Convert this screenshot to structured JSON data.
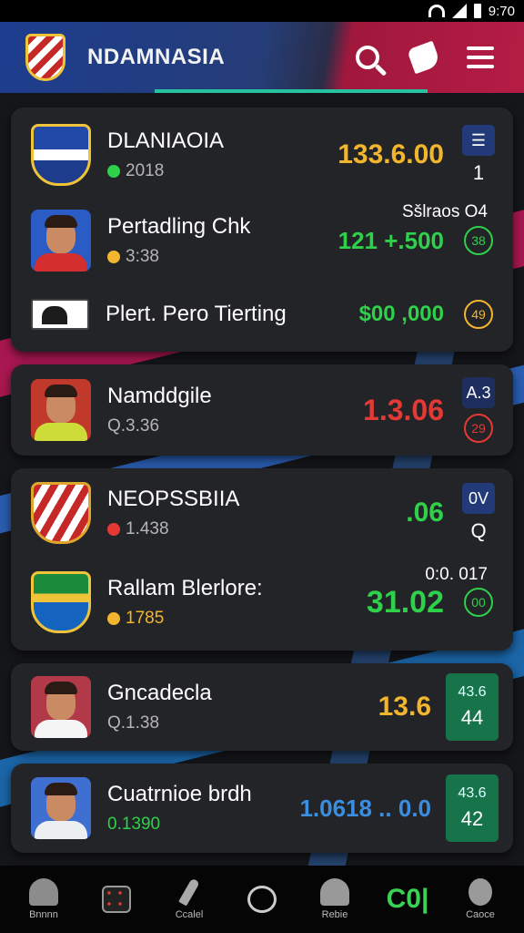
{
  "status_bar": {
    "time": "9:70"
  },
  "header": {
    "app_title": "NDAMNASIA",
    "icons": [
      "search-icon",
      "tag-icon",
      "menu-icon"
    ]
  },
  "cards": [
    {
      "rows": [
        {
          "name": "DLANIAOIA",
          "sub": "2018",
          "value": "133.6.00",
          "value_color": "#f2b62e",
          "chip": "",
          "badge": "1",
          "icon": "team-crest-icon"
        },
        {
          "name": "Pertadling Chk",
          "sub": "3:38",
          "value": "121 +.500",
          "value_color": "#2fd04a",
          "top_right": "Sšlraos O4",
          "ring": "38",
          "ring_color": "#2fd04a",
          "icon": "player-avatar"
        },
        {
          "name": "Plert. Pero Tierting",
          "sub": "",
          "value": "$00 ,000",
          "value_color": "#2fd04a",
          "ring": "49",
          "ring_color": "#f2b62e",
          "icon": "brand-logo"
        }
      ]
    },
    {
      "rows": [
        {
          "name": "Namddgile",
          "sub": "Q.3.36",
          "value": "1.3.06",
          "value_color": "#e53935",
          "chip": "A.3",
          "ring": "29",
          "ring_color": "#e53935",
          "icon": "player-avatar"
        }
      ]
    },
    {
      "rows": [
        {
          "name": "NEOPSSBIIA",
          "sub": "1.438",
          "value": ".06",
          "value_color": "#2fd04a",
          "chip": "0V",
          "badge": "Q",
          "icon": "team-crest-icon"
        },
        {
          "name": "Rallam Blerlore:",
          "sub": "1785",
          "value": "31.02",
          "value_color": "#2fd04a",
          "top_right": "0:0. 017",
          "ring": "00",
          "ring_color": "#2fd04a",
          "icon": "team-crest-icon"
        }
      ]
    },
    {
      "rows": [
        {
          "name": "Gncadecla",
          "sub": "Q.1.38",
          "value": "13.6",
          "value_color": "#f2b62e",
          "box_top": "43.6",
          "box_bottom": "44",
          "icon": "player-avatar"
        }
      ]
    },
    {
      "rows": [
        {
          "name": "Cuatrnioe brdh",
          "sub": "0.1390",
          "value": "1.0618 .. 0.0",
          "value_color": "#3b8de0",
          "box_top": "43.6",
          "box_bottom": "42",
          "icon": "player-avatar"
        }
      ]
    }
  ],
  "bottom_nav": [
    {
      "icon": "person-icon",
      "label": "Bnnnn"
    },
    {
      "icon": "grid-icon",
      "label": ""
    },
    {
      "icon": "rocket-icon",
      "label": "Ccalel"
    },
    {
      "icon": "clock-icon",
      "label": ""
    },
    {
      "icon": "bell-icon",
      "label": "Rebie"
    },
    {
      "icon": "",
      "label": "",
      "text": "C0|"
    },
    {
      "icon": "chat-icon",
      "label": "Caoce"
    }
  ],
  "colors": {
    "accent_green": "#2fd04a",
    "accent_gold": "#f2b62e",
    "accent_red": "#e53935",
    "header_blue": "#1d3d8f",
    "header_red": "#b51c45"
  }
}
